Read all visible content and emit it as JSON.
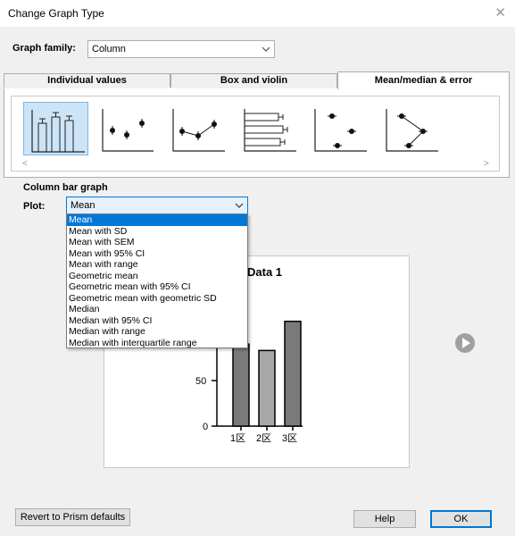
{
  "window": {
    "title": "Change Graph Type",
    "close_symbol": "✕"
  },
  "graph_family": {
    "label": "Graph family:",
    "value": "Column"
  },
  "tabs": [
    {
      "label": "Individual values"
    },
    {
      "label": "Box and violin"
    },
    {
      "label": "Mean/median & error"
    }
  ],
  "gallery": {
    "scroll_left": "<",
    "scroll_right": ">"
  },
  "section": {
    "title": "Column bar graph"
  },
  "plot": {
    "label": "Plot:",
    "value": "Mean",
    "options": [
      "Mean",
      "Mean with SD",
      "Mean with SEM",
      "Mean with 95% CI",
      "Mean with range",
      "Geometric mean",
      "Geometric mean with 95% CI",
      "Geometric mean with geometric SD",
      "Median",
      "Median with 95% CI",
      "Median with range",
      "Median with interquartile range"
    ]
  },
  "preview": {
    "chart_data": {
      "type": "bar",
      "title": "Data 1",
      "categories": [
        "1区",
        "2区",
        "3区"
      ],
      "values": [
        90,
        83,
        115
      ],
      "yticks": [
        "50",
        "0"
      ],
      "ylim": [
        0,
        140
      ]
    }
  },
  "buttons": {
    "revert": "Revert to Prism defaults",
    "help": "Help",
    "ok": "OK"
  },
  "colors": {
    "bar_fill": "#888888",
    "selection": "#0078d7",
    "thumb_selected": "#cce4f7"
  }
}
